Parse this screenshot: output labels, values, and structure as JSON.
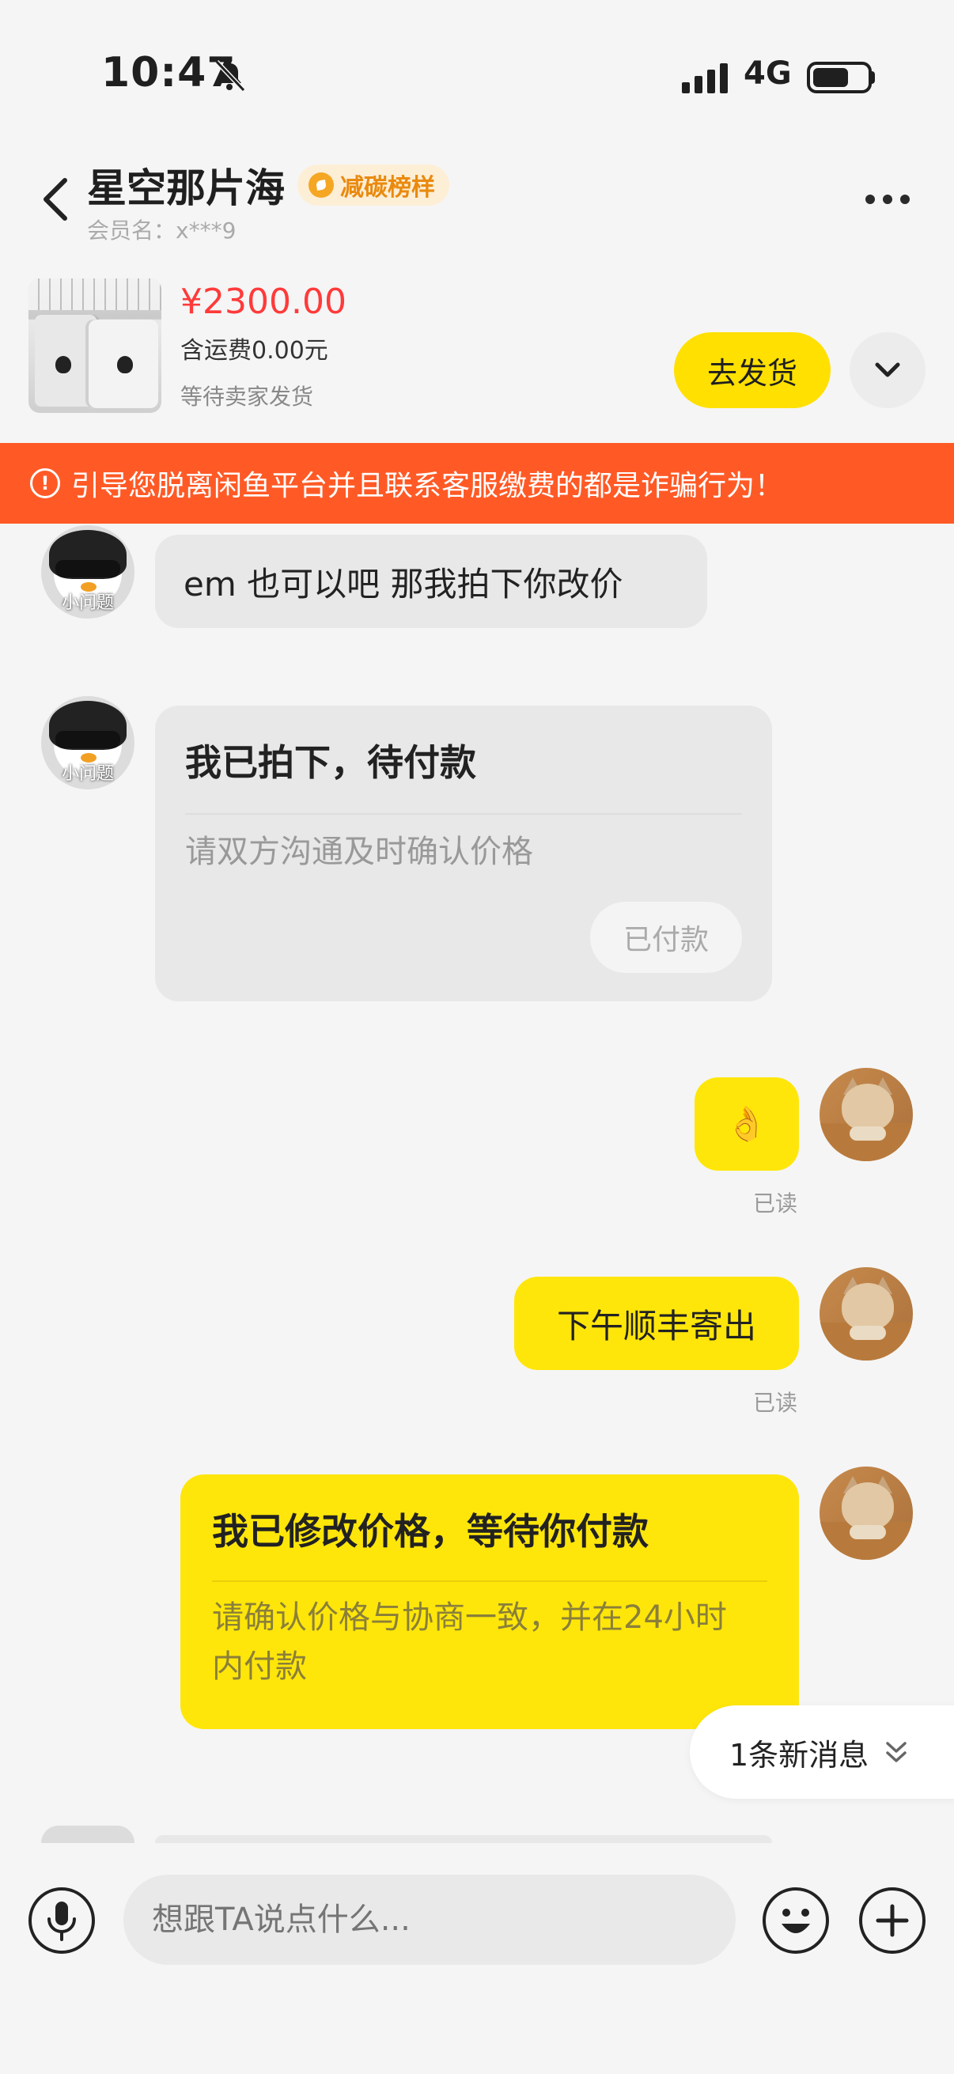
{
  "status_bar": {
    "time": "10:47",
    "network": "4G"
  },
  "header": {
    "title": "星空那片海",
    "badge": "减碳榜样",
    "member": "会员名：x***9"
  },
  "product": {
    "price": "¥2300.00",
    "shipping": "含运费0.00元",
    "status": "等待卖家发货",
    "ship_button": "去发货"
  },
  "warning": "引导您脱离闲鱼平台并且联系客服缴费的都是诈骗行为！",
  "messages": [
    {
      "side": "left",
      "text": "em 也可以吧 那我拍下你改价",
      "avatar_caption": "小问题"
    },
    {
      "side": "left",
      "type": "card",
      "title": "我已拍下，待付款",
      "subtitle": "请双方沟通及时确认价格",
      "button": "已付款",
      "avatar_caption": "小问题"
    },
    {
      "side": "right",
      "text": "👌",
      "read": "已读"
    },
    {
      "side": "right",
      "text": "下午顺丰寄出",
      "read": "已读"
    },
    {
      "side": "right",
      "type": "card",
      "title": "我已修改价格，等待你付款",
      "subtitle": "请确认价格与协商一致，并在24小时内付款"
    }
  ],
  "new_message": "1条新消息",
  "input": {
    "placeholder": "想跟TA说点什么..."
  },
  "colors": {
    "accent": "#ffe60a",
    "warning": "#ff5a26",
    "price": "#ff3a3a"
  }
}
